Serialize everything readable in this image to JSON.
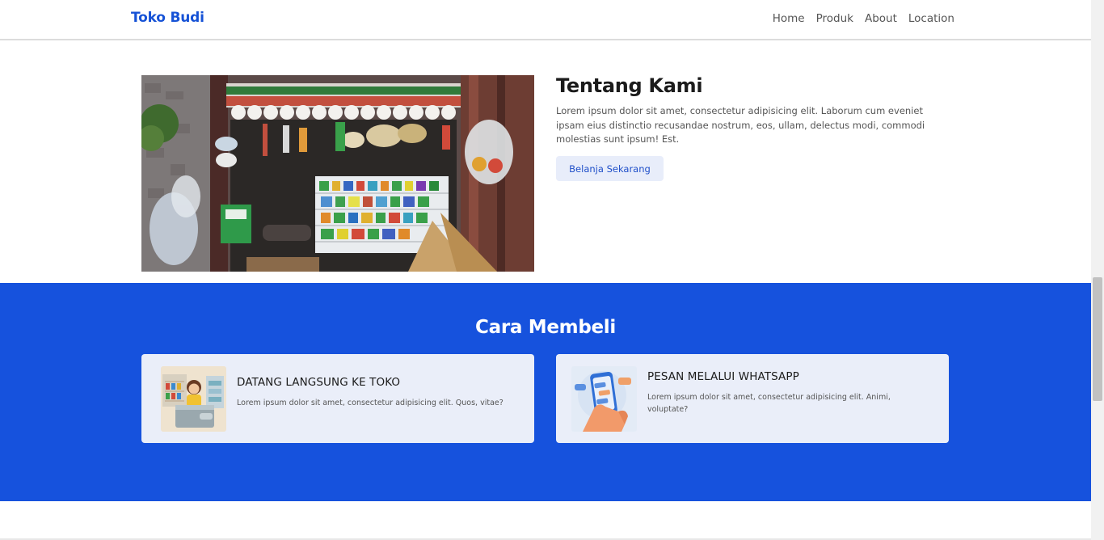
{
  "navbar": {
    "brand": "Toko Budi",
    "links": [
      "Home",
      "Produk",
      "About",
      "Location"
    ]
  },
  "about": {
    "image_alt": "Toko Budi storefront",
    "title": "Tentang Kami",
    "text": "Lorem ipsum dolor sit amet, consectetur adipisicing elit. Laborum cum eveniet ipsam eius distinctio recusandae nostrum, eos, ullam, delectus modi, commodi molestias sunt ipsum! Est.",
    "button": "Belanja Sekarang"
  },
  "howto": {
    "title": "Cara Membeli",
    "cards": [
      {
        "title": "DATANG LANGSUNG KE TOKO",
        "text": "Lorem ipsum dolor sit amet, consectetur adipisicing elit. Quos, vitae?",
        "icon": "store-clerk-illustration"
      },
      {
        "title": "PESAN MELALUI WHATSAPP",
        "text": "Lorem ipsum dolor sit amet, consectetur adipisicing elit. Animi, voluptate?",
        "icon": "phone-chat-illustration"
      }
    ]
  },
  "colors": {
    "brand": "#1652d6",
    "section_bg": "#1652dd",
    "card_bg": "#eaeef9",
    "button_bg": "#e8edfa"
  }
}
